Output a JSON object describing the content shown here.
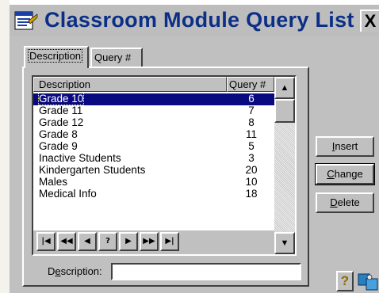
{
  "window": {
    "title": "Classroom Module Query List",
    "close_label": "X"
  },
  "tabs": [
    {
      "label": "Description",
      "active": true
    },
    {
      "label": "Query #",
      "active": false
    }
  ],
  "list": {
    "columns": [
      "Description",
      "Query #"
    ],
    "rows": [
      {
        "description": "Grade 10",
        "query": "6",
        "selected": true
      },
      {
        "description": "Grade 11",
        "query": "7"
      },
      {
        "description": "Grade 12",
        "query": "8"
      },
      {
        "description": "Grade 8",
        "query": "11"
      },
      {
        "description": "Grade 9",
        "query": "5"
      },
      {
        "description": "Inactive Students",
        "query": "3"
      },
      {
        "description": "Kindergarten Students",
        "query": "20"
      },
      {
        "description": "Males",
        "query": "10"
      },
      {
        "description": "Medical Info",
        "query": "18"
      }
    ]
  },
  "navigator": {
    "buttons": [
      {
        "name": "first-record-icon",
        "glyph": "|◀"
      },
      {
        "name": "prior-page-icon",
        "glyph": "◀◀"
      },
      {
        "name": "prior-record-icon",
        "glyph": "◀"
      },
      {
        "name": "help-query-icon",
        "glyph": "?"
      },
      {
        "name": "next-record-icon",
        "glyph": "▶"
      },
      {
        "name": "next-page-icon",
        "glyph": "▶▶"
      },
      {
        "name": "last-record-icon",
        "glyph": "▶|"
      }
    ]
  },
  "description_field": {
    "label": "Description:",
    "value": ""
  },
  "actions": {
    "insert": "Insert",
    "change": "Change",
    "delete": "Delete"
  },
  "icons": {
    "help": "?"
  },
  "colors": {
    "title_text": "#0b2f86",
    "selection": "#0a0a80",
    "face": "#c0c0c0"
  }
}
